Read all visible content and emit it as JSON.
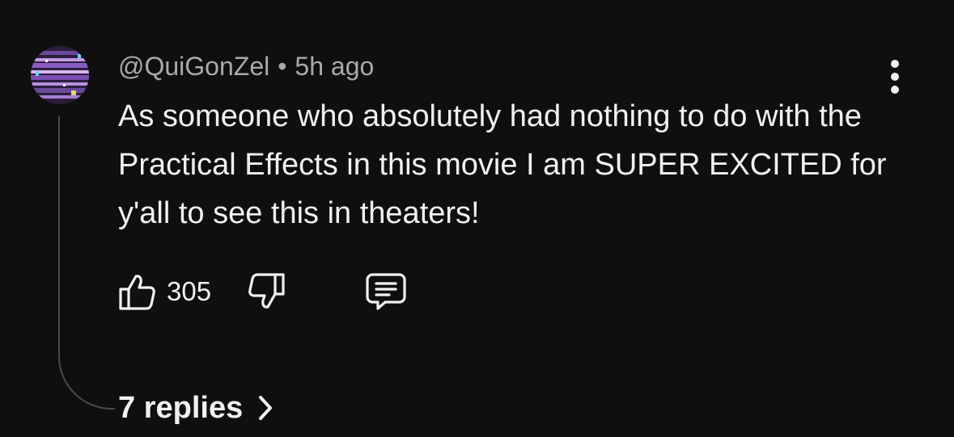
{
  "comment": {
    "author": "@QuiGonZel",
    "separator": "•",
    "timestamp": "5h ago",
    "text": "As someone who absolutely had nothing to do with the Practical Effects in this movie I am SUPER EXCITED for y'all to see this in theaters!",
    "like_count": "305",
    "replies_label": "7 replies"
  },
  "icons": {
    "like": "thumbs-up-icon",
    "dislike": "thumbs-down-icon",
    "reply": "comment-bubble-icon",
    "menu": "more-vert-icon",
    "chevron": "chevron-right-icon"
  },
  "colors": {
    "background": "#0f0f0f",
    "primary_text": "#f1f1f1",
    "secondary_text": "#aaaaaa",
    "thread_line": "#4a4a4a"
  }
}
